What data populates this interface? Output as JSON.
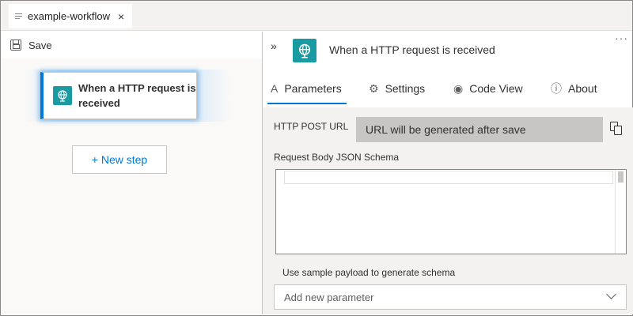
{
  "tab": {
    "title": "example-workflow",
    "close": "×"
  },
  "toolbar": {
    "save_label": "Save"
  },
  "canvas": {
    "trigger_title": "When a HTTP request is received",
    "new_step_label": "+ New step"
  },
  "panel": {
    "collapse": "»",
    "title": "When a HTTP request is received",
    "more": "···",
    "tabs": [
      {
        "label": "Parameters",
        "icon": "text-a-icon",
        "glyph": "A"
      },
      {
        "label": "Settings",
        "icon": "gear-icon",
        "glyph": "⚙"
      },
      {
        "label": "Code View",
        "icon": "eye-icon",
        "glyph": "◉"
      },
      {
        "label": "About",
        "icon": "info-icon",
        "glyph": "ⓘ"
      }
    ],
    "http_post_url_label": "HTTP POST URL",
    "http_post_url_value": "URL will be generated after save",
    "schema_label": "Request Body JSON Schema",
    "sample_payload_link": "Use sample payload to generate schema",
    "add_parameter_placeholder": "Add new parameter"
  },
  "colors": {
    "accent": "#0078d4",
    "app_icon": "#1a9ba1",
    "disabled_field": "#c8c6c4"
  }
}
